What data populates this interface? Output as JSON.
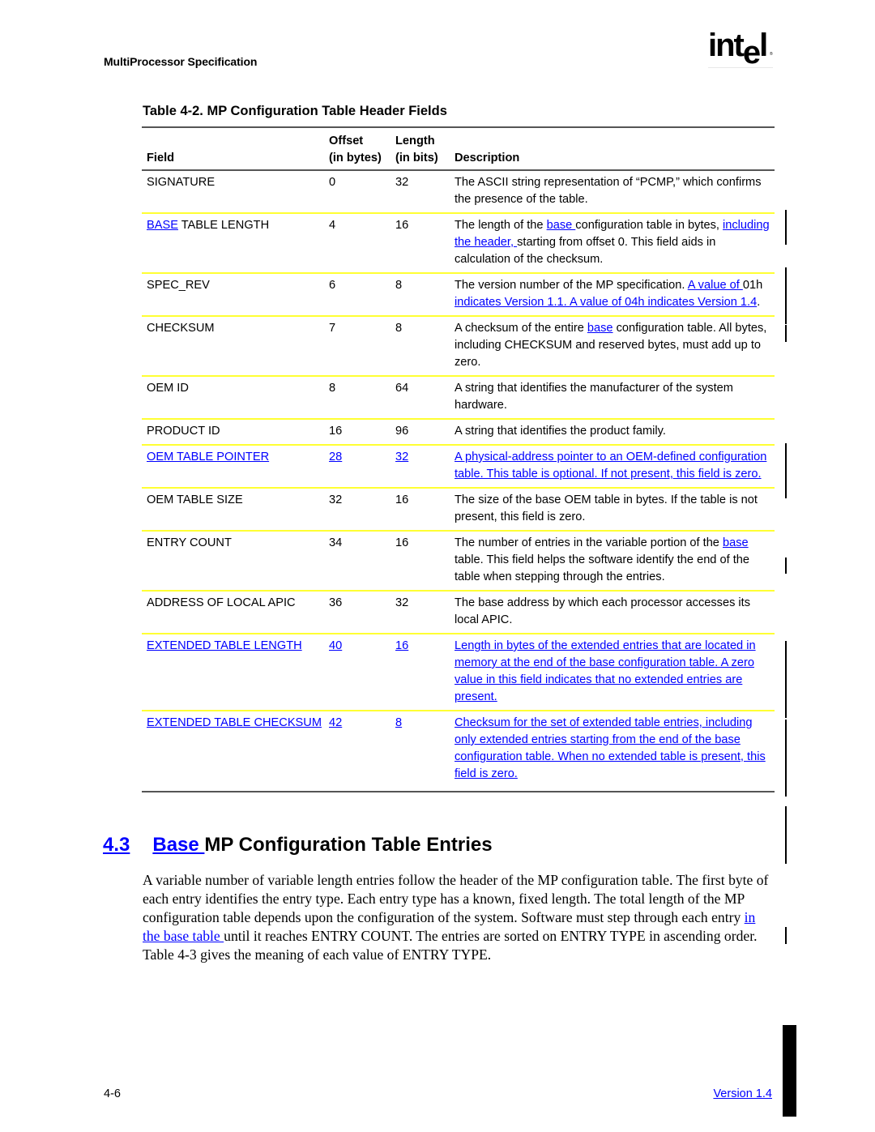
{
  "header": {
    "running_head": "MultiProcessor Specification",
    "logo": {
      "word_start": "int",
      "word_e": "e",
      "word_end": "l",
      "reg_mark": "®"
    }
  },
  "table": {
    "title": "Table 4-2.  MP Configuration Table Header Fields",
    "columns": [
      {
        "line1": "",
        "line2": "Field"
      },
      {
        "line1": "Offset",
        "line2": "(in bytes)"
      },
      {
        "line1": "Length",
        "line2": "(in bits)"
      },
      {
        "line1": "",
        "line2": "Description"
      }
    ],
    "rows": [
      {
        "field": [
          {
            "text": "SIGNATURE",
            "link": false
          }
        ],
        "offset": {
          "text": "0",
          "link": false
        },
        "length": {
          "text": "32",
          "link": false
        },
        "description": [
          {
            "text": "The ASCII string representation of “PCMP,” which confirms the presence of the table.",
            "link": false
          }
        ]
      },
      {
        "field": [
          {
            "text": "BASE",
            "link": true
          },
          {
            "text": " TABLE LENGTH",
            "link": false
          }
        ],
        "offset": {
          "text": "4",
          "link": false
        },
        "length": {
          "text": "16",
          "link": false
        },
        "description": [
          {
            "text": "The length of the ",
            "link": false
          },
          {
            "text": "base ",
            "link": true
          },
          {
            "text": "configuration table in bytes, ",
            "link": false
          },
          {
            "text": "including the header, ",
            "link": true
          },
          {
            "text": "starting from offset 0.  This field aids in calculation of the checksum.",
            "link": false
          }
        ]
      },
      {
        "field": [
          {
            "text": "SPEC_REV",
            "link": false
          }
        ],
        "offset": {
          "text": "6",
          "link": false
        },
        "length": {
          "text": "8",
          "link": false
        },
        "description": [
          {
            "text": "The version number of the MP specification. ",
            "link": false
          },
          {
            "text": " A value of ",
            "link": true
          },
          {
            "text": "01h",
            "link": false
          },
          {
            "text": " indicates Version 1.1.  A value of 04h indicates Version 1.4",
            "link": true
          },
          {
            "text": ".",
            "link": false
          }
        ]
      },
      {
        "field": [
          {
            "text": "CHECKSUM",
            "link": false
          }
        ],
        "offset": {
          "text": "7",
          "link": false
        },
        "length": {
          "text": "8",
          "link": false
        },
        "description": [
          {
            "text": "A checksum of the entire ",
            "link": false
          },
          {
            "text": "base",
            "link": true
          },
          {
            "text": " configuration table.  All bytes, including CHECKSUM and reserved bytes, must add up to zero.",
            "link": false
          }
        ]
      },
      {
        "field": [
          {
            "text": "OEM ID",
            "link": false
          }
        ],
        "offset": {
          "text": "8",
          "link": false
        },
        "length": {
          "text": "64",
          "link": false
        },
        "description": [
          {
            "text": "A string that identifies the manufacturer of the system hardware.",
            "link": false
          }
        ]
      },
      {
        "field": [
          {
            "text": "PRODUCT ID",
            "link": false
          }
        ],
        "offset": {
          "text": "16",
          "link": false
        },
        "length": {
          "text": "96",
          "link": false
        },
        "description": [
          {
            "text": "A string that identifies the product family.",
            "link": false
          }
        ]
      },
      {
        "field": [
          {
            "text": "OEM TABLE POINTER",
            "link": true
          }
        ],
        "offset": {
          "text": "28",
          "link": true
        },
        "length": {
          "text": "32",
          "link": true
        },
        "description": [
          {
            "text": "A physical-address pointer to an OEM-defined configuration table.  This table is optional.  If not present, this field is zero.",
            "link": true
          }
        ]
      },
      {
        "field": [
          {
            "text": "OEM TABLE SIZE",
            "link": false
          }
        ],
        "offset": {
          "text": "32",
          "link": false
        },
        "length": {
          "text": "16",
          "link": false
        },
        "description": [
          {
            "text": "The size of the base OEM table in bytes.  If the table is not present, this field is zero.",
            "link": false
          }
        ]
      },
      {
        "field": [
          {
            "text": "ENTRY COUNT",
            "link": false
          }
        ],
        "offset": {
          "text": "34",
          "link": false
        },
        "length": {
          "text": "16",
          "link": false
        },
        "description": [
          {
            "text": "The number of entries in the variable portion of the ",
            "link": false
          },
          {
            "text": "base ",
            "link": true
          },
          {
            "text": "table.  This field helps the software identify the end of the table when stepping through the entries.",
            "link": false
          }
        ]
      },
      {
        "field": [
          {
            "text": "ADDRESS OF LOCAL APIC",
            "link": false
          }
        ],
        "offset": {
          "text": "36",
          "link": false
        },
        "length": {
          "text": "32",
          "link": false
        },
        "description": [
          {
            "text": "The base address by which each processor accesses its local APIC.",
            "link": false
          }
        ]
      },
      {
        "field": [
          {
            "text": "EXTENDED TABLE LENGTH",
            "link": true
          }
        ],
        "offset": {
          "text": "40",
          "link": true
        },
        "length": {
          "text": "16",
          "link": true
        },
        "description": [
          {
            "text": "Length in bytes of the extended entries that are located in memory at the end of the base configuration table.  A zero value in this field indicates that no extended entries are present.",
            "link": true
          }
        ]
      },
      {
        "field": [
          {
            "text": "EXTENDED TABLE CHECKSUM",
            "link": true
          }
        ],
        "offset": {
          "text": "42",
          "link": true
        },
        "length": {
          "text": "8",
          "link": true
        },
        "description": [
          {
            "text": "Checksum for the set of extended table entries, including only extended entries starting from the end of the base configuration table.  When no extended table is present, this field is zero.",
            "link": true
          }
        ]
      }
    ]
  },
  "section": {
    "number": "4.3",
    "title_link": "Base ",
    "title_rest": "MP Configuration Table Entries",
    "paragraph": [
      {
        "text": "A variable number of variable length entries follow the header of the MP configuration table.  The first byte of each entry identifies the entry type.  Each entry type has a known, fixed length.  The total length of the MP configuration table depends upon the configuration of the system.  Software must step through each entry ",
        "link": false
      },
      {
        "text": "in the base table ",
        "link": true
      },
      {
        "text": "until it reaches ENTRY COUNT.  The entries are sorted on ENTRY TYPE in ascending order.  Table 4-3 gives the meaning of each value of ENTRY TYPE.",
        "link": false
      }
    ]
  },
  "footer": {
    "page_number": "4-6",
    "version": "Version 1.4"
  },
  "colors": {
    "link": "#0000ff",
    "row_separator": "#ffff33",
    "rule": "#555555"
  }
}
